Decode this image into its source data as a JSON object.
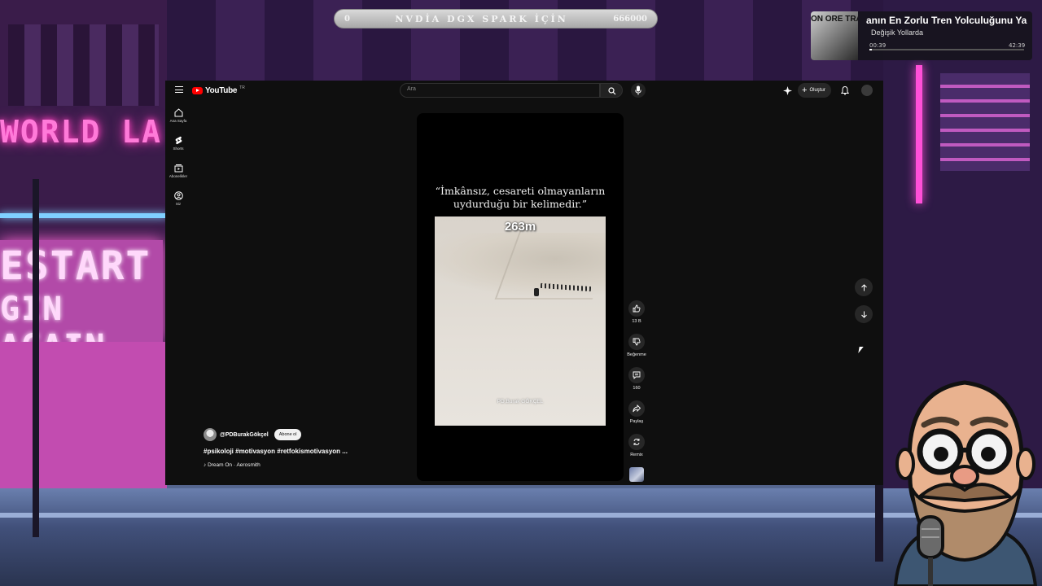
{
  "stream_overlay": {
    "left_value": "0",
    "title": "NVDİA DGX SPARK İÇİN",
    "right_value": "666000"
  },
  "now_playing": {
    "album_art_text": "ON ORE TRA",
    "song_title": "anın En Zorlu Tren Yolculuğunu Ya",
    "artist": "Değişik Yollarda",
    "elapsed": "00:39",
    "duration": "42:39",
    "progress_fraction": 0.015
  },
  "youtube": {
    "logo_text": "YouTube",
    "logo_region": "TR",
    "search_placeholder": "Ara",
    "create_label": "Oluştur",
    "guide": [
      {
        "label": "Ana Sayfa",
        "icon": "home-icon"
      },
      {
        "label": "Shorts",
        "icon": "shorts-icon"
      },
      {
        "label": "Abonelikler",
        "icon": "subscriptions-icon"
      },
      {
        "label": "Siz",
        "icon": "you-icon"
      }
    ],
    "short": {
      "quote": "“İmkânsız, cesareti olmayanların uydurduğu bir kelimedir.”",
      "distance_overlay": "263m",
      "watermark": "PD.Burak GÖKÇEL"
    },
    "actions": {
      "like_count": "13 B",
      "dislike_label": "Beğenme",
      "comment_count": "160",
      "share_label": "Paylaş",
      "remix_label": "Remix"
    },
    "meta": {
      "channel": "@PDBurakGökçel",
      "subscribe_label": "Abone ol",
      "title": "#psikoloji #motivasyon #retfokismotivasyon ...",
      "music": "Dream On · Aerosmith"
    }
  },
  "background": {
    "sign_top": "WORLD LA",
    "sign_line1": "ESTART",
    "sign_line2": "GIN AGAIN"
  }
}
